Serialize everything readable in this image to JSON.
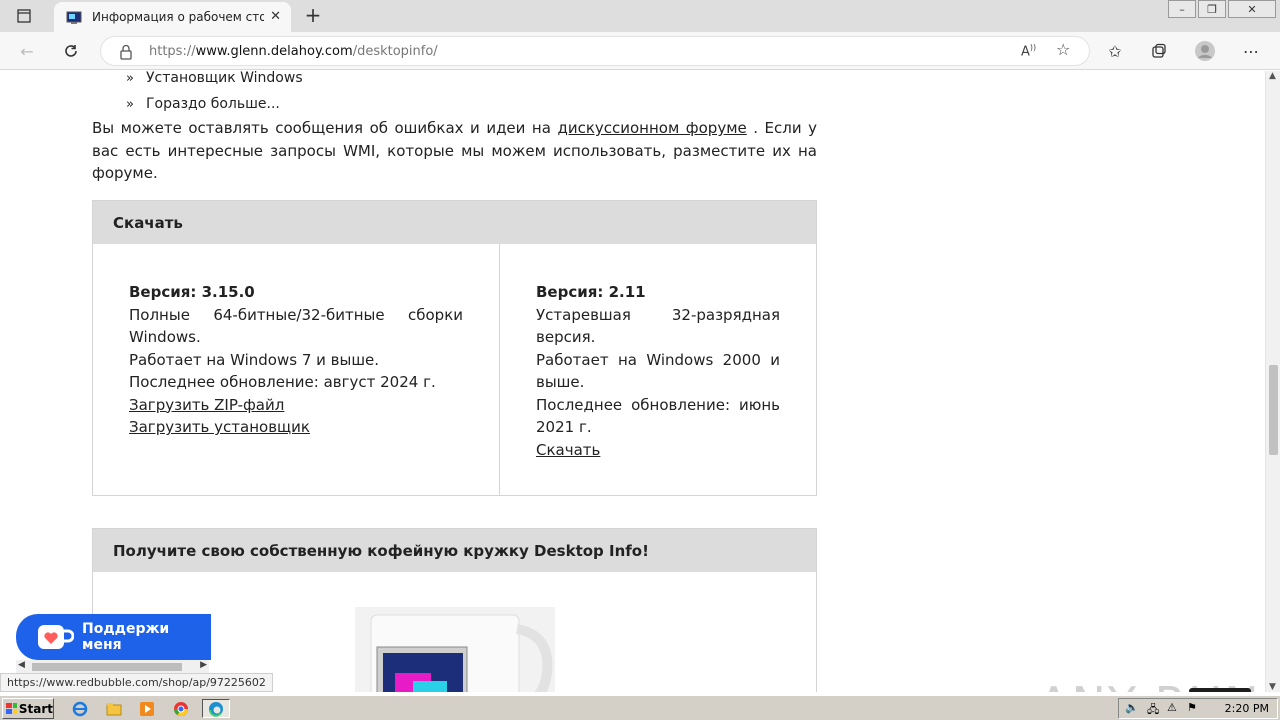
{
  "browser": {
    "tab_title": "Информация о рабочем столе",
    "url_prefix": "https://",
    "url_host": "www.glenn.delahoy.com",
    "url_path": "/desktopinfo/"
  },
  "page": {
    "bullets": [
      "Установщик Windows",
      "Гораздо больше..."
    ],
    "para_text_1": "Вы можете оставлять сообщения об ошибках и идеи на ",
    "para_link": "дискуссионном форуме",
    "para_text_2": " . Если у вас есть интересные запросы WMI, которые мы можем использовать, разместите их на форуме.",
    "download": {
      "header": "Скачать",
      "left": {
        "version": "Версия: 3.15.0",
        "desc": "Полные 64-битные/32-битные сборки Windows.",
        "req": "Работает на Windows 7 и выше.",
        "updated": "Последнее обновление: август 2024 г.",
        "link_zip": "Загрузить ZIP-файл",
        "link_installer": "Загрузить установщик"
      },
      "right": {
        "version": "Версия: 2.11",
        "desc": "Устаревшая 32-разрядная версия.",
        "req": "Работает на Windows 2000 и выше.",
        "updated": "Последнее обновление: июнь 2021 г.",
        "link": "Скачать"
      }
    },
    "mug_header": "Получите свою собственную кофейную кружку Desktop Info!",
    "support_button": "Поддержи меня"
  },
  "status_url": "https://www.redbubble.com/shop/ap/97225602",
  "watermark": "ANY RUN",
  "taskbar": {
    "start_label": "Start",
    "clock": "2:20 PM"
  },
  "colors": {
    "support_blue": "#1f62ea",
    "header_gray": "#dcdcdc",
    "tab_strip": "#dedede"
  }
}
